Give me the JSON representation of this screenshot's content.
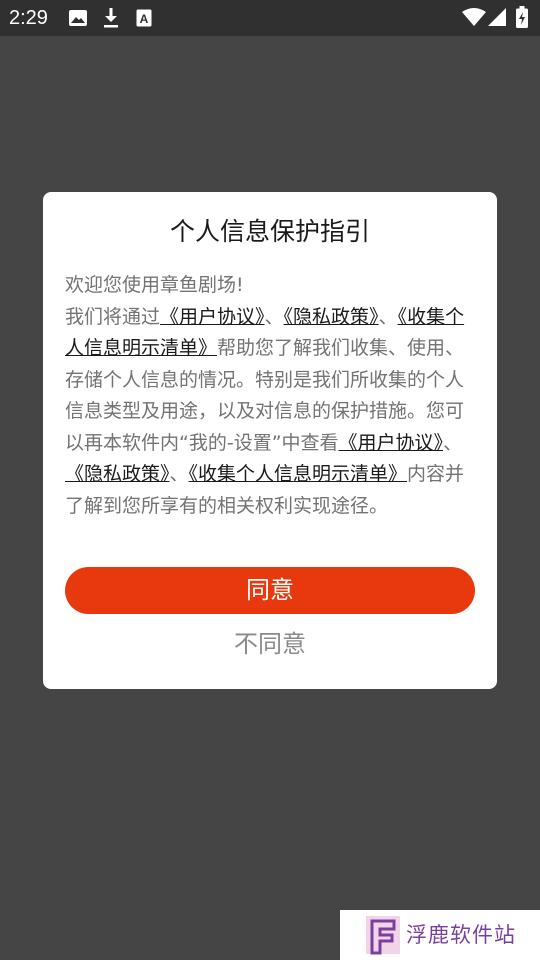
{
  "status_bar": {
    "time": "2:29",
    "left_icons": [
      "image-icon",
      "download-icon",
      "font-a-icon"
    ],
    "right_icons": [
      "wifi-icon",
      "cell-signal-icon",
      "battery-icon"
    ]
  },
  "dialog": {
    "title": "个人信息保护指引",
    "body": [
      {
        "text": "欢迎您使用章鱼剧场!",
        "link": false
      },
      {
        "text": "\n我们将通过",
        "link": false
      },
      {
        "text": "《用户协议》",
        "link": true
      },
      {
        "text": "、",
        "link": false
      },
      {
        "text": "《隐私政策》",
        "link": true
      },
      {
        "text": "、",
        "link": false
      },
      {
        "text": "《收集个人信息明示清单》",
        "link": true
      },
      {
        "text": "帮助您了解我们收集、使用、存储个人信息的情况。特别是我们所收集的个人信息类型及用途，以及对信息的保护措施。您可以再本软件内“我的-设置”中查看",
        "link": false
      },
      {
        "text": "《用户协议》",
        "link": true
      },
      {
        "text": "、",
        "link": false
      },
      {
        "text": "《隐私政策》",
        "link": true
      },
      {
        "text": "、",
        "link": false
      },
      {
        "text": "《收集个人信息明示清单》",
        "link": true
      },
      {
        "text": "内容并了解到您所享有的相关权利实现途径。",
        "link": false
      }
    ],
    "agree_label": "同意",
    "disagree_label": "不同意"
  },
  "watermark": {
    "text": "浮鹿软件站",
    "logo_icon": "watermark-logo-icon"
  },
  "colors": {
    "background": "#454545",
    "status_bar": "#303030",
    "accent": "#e8390e",
    "body_text": "#737373",
    "link_text": "#1a1a1a"
  }
}
